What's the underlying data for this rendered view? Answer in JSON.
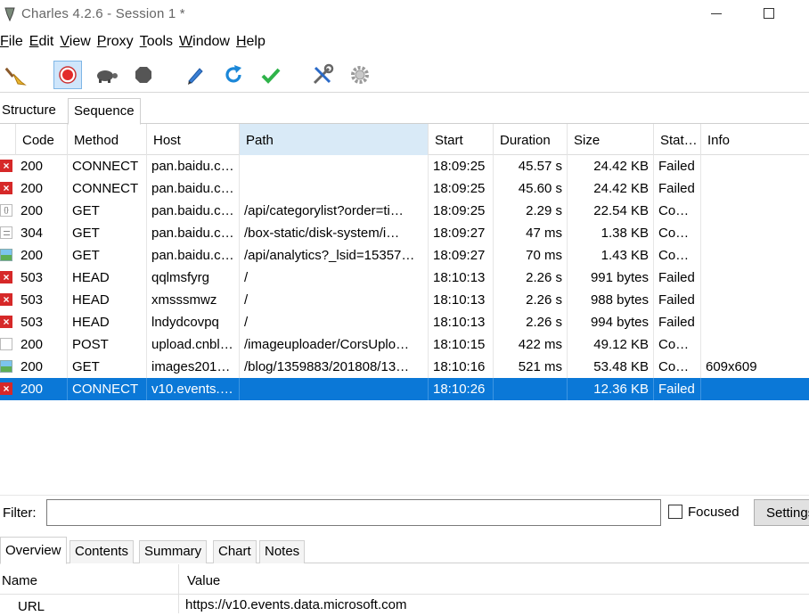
{
  "window": {
    "title": "Charles 4.2.6 - Session 1 *"
  },
  "menu": [
    {
      "u": "F",
      "rest": "ile"
    },
    {
      "u": "E",
      "rest": "dit"
    },
    {
      "u": "V",
      "rest": "iew"
    },
    {
      "u": "P",
      "rest": "roxy"
    },
    {
      "u": "T",
      "rest": "ools"
    },
    {
      "u": "W",
      "rest": "indow"
    },
    {
      "u": "H",
      "rest": "elp"
    }
  ],
  "toolbar": {
    "icons": [
      "broom-icon",
      "record-icon",
      "throttle-turtle-icon",
      "breakpoints-stop-icon",
      "compose-pen-icon",
      "repeat-refresh-icon",
      "validate-check-icon",
      "tools-icon",
      "settings-gear-icon"
    ]
  },
  "view_tabs": [
    "Structure",
    "Sequence"
  ],
  "table": {
    "columns": [
      "Code",
      "Method",
      "Host",
      "Path",
      "Start",
      "Duration",
      "Size",
      "Stat…",
      "Info"
    ],
    "rows": [
      {
        "icon": "fail",
        "code": "200",
        "method": "CONNECT",
        "host": "pan.baidu.c…",
        "path": "",
        "start": "18:09:25",
        "duration": "45.57 s",
        "size": "24.42 KB",
        "status": "Failed",
        "info": ""
      },
      {
        "icon": "fail",
        "code": "200",
        "method": "CONNECT",
        "host": "pan.baidu.c…",
        "path": "",
        "start": "18:09:25",
        "duration": "45.60 s",
        "size": "24.42 KB",
        "status": "Failed",
        "info": ""
      },
      {
        "icon": "json",
        "code": "200",
        "method": "GET",
        "host": "pan.baidu.c…",
        "path": "/api/categorylist?order=ti…",
        "start": "18:09:25",
        "duration": "2.29 s",
        "size": "22.54 KB",
        "status": "Co…",
        "info": ""
      },
      {
        "icon": "css",
        "code": "304",
        "method": "GET",
        "host": "pan.baidu.c…",
        "path": "/box-static/disk-system/i…",
        "start": "18:09:27",
        "duration": "47 ms",
        "size": "1.38 KB",
        "status": "Co…",
        "info": ""
      },
      {
        "icon": "img",
        "code": "200",
        "method": "GET",
        "host": "pan.baidu.c…",
        "path": "/api/analytics?_lsid=15357…",
        "start": "18:09:27",
        "duration": "70 ms",
        "size": "1.43 KB",
        "status": "Co…",
        "info": ""
      },
      {
        "icon": "fail",
        "code": "503",
        "method": "HEAD",
        "host": "qqlmsfyrg",
        "path": "/",
        "start": "18:10:13",
        "duration": "2.26 s",
        "size": "991 bytes",
        "status": "Failed",
        "info": ""
      },
      {
        "icon": "fail",
        "code": "503",
        "method": "HEAD",
        "host": "xmsssmwz",
        "path": "/",
        "start": "18:10:13",
        "duration": "2.26 s",
        "size": "988 bytes",
        "status": "Failed",
        "info": ""
      },
      {
        "icon": "fail",
        "code": "503",
        "method": "HEAD",
        "host": "lndydcovpq",
        "path": "/",
        "start": "18:10:13",
        "duration": "2.26 s",
        "size": "994 bytes",
        "status": "Failed",
        "info": ""
      },
      {
        "icon": "doc",
        "code": "200",
        "method": "POST",
        "host": "upload.cnbl…",
        "path": "/imageuploader/CorsUplo…",
        "start": "18:10:15",
        "duration": "422 ms",
        "size": "49.12 KB",
        "status": "Co…",
        "info": ""
      },
      {
        "icon": "img",
        "code": "200",
        "method": "GET",
        "host": "images201…",
        "path": "/blog/1359883/201808/13…",
        "start": "18:10:16",
        "duration": "521 ms",
        "size": "53.48 KB",
        "status": "Co…",
        "info": "609x609"
      },
      {
        "icon": "fail",
        "code": "200",
        "method": "CONNECT",
        "host": "v10.events.…",
        "path": "",
        "start": "18:10:26",
        "duration": "",
        "size": "12.36 KB",
        "status": "Failed",
        "info": "",
        "selected": true
      }
    ]
  },
  "filter": {
    "label": "Filter:",
    "value": "",
    "focused_label": "Focused",
    "focused_checked": false,
    "settings_label": "Settings"
  },
  "bottom_tabs": [
    "Overview",
    "Contents",
    "Summary",
    "Chart",
    "Notes"
  ],
  "detail": {
    "name_header": "Name",
    "value_header": "Value",
    "rows": [
      {
        "name": "URL",
        "value": "https://v10.events.data.microsoft.com"
      }
    ]
  }
}
